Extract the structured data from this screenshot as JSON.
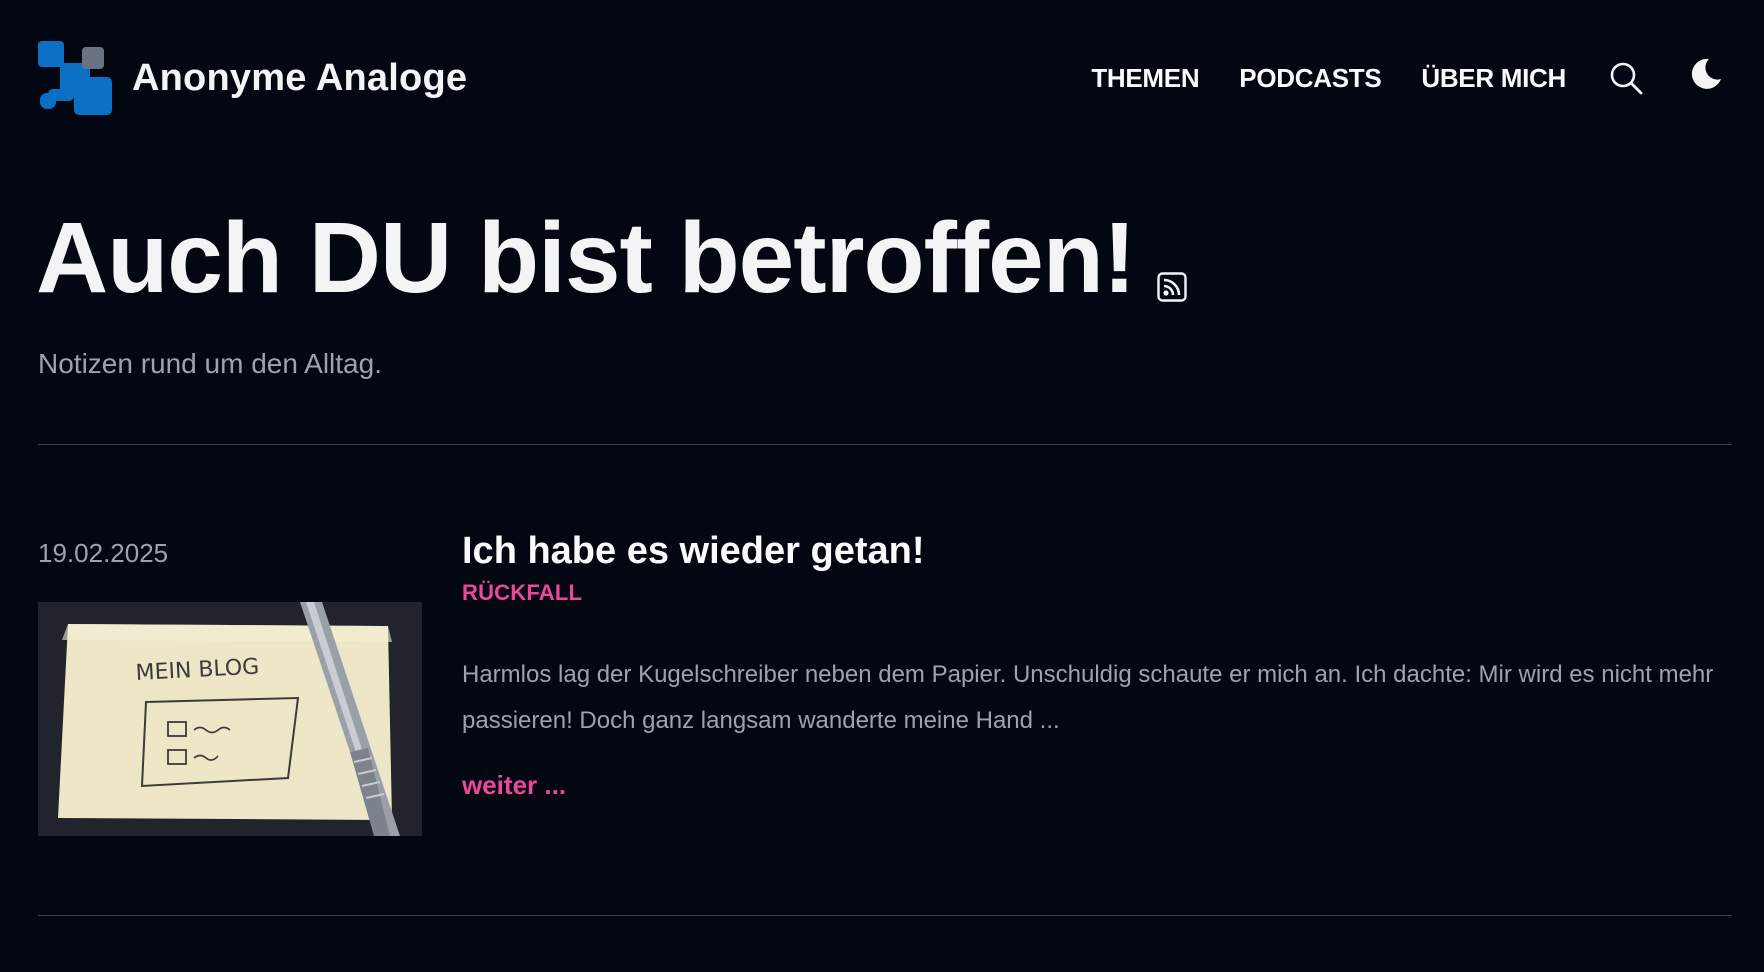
{
  "site": {
    "name": "Anonyme Analoge",
    "logo_icon": "site-logo-icon",
    "accent_blue": "#0b6fc4",
    "accent_pink": "#ec4899"
  },
  "nav": {
    "items": [
      {
        "label": "THEMEN"
      },
      {
        "label": "PODCASTS"
      },
      {
        "label": "ÜBER MICH"
      }
    ],
    "search_icon": "search-icon",
    "theme_icon": "moon-icon"
  },
  "hero": {
    "title": "Auch DU bist betroffen!",
    "rss_icon": "rss-icon",
    "subtitle": "Notizen rund um den Alltag."
  },
  "post": {
    "date": "19.02.2025",
    "title": "Ich habe es wieder getan!",
    "category": "RÜCKFALL",
    "excerpt": "Harmlos lag der Kugelschreiber neben dem Papier. Unschuldig schaute er mich an. Ich dachte: Mir wird es nicht mehr passieren! Doch ganz langsam wanderte meine Hand ...",
    "more": "weiter ...",
    "thumbnail_text": "MEIN BLOG"
  }
}
